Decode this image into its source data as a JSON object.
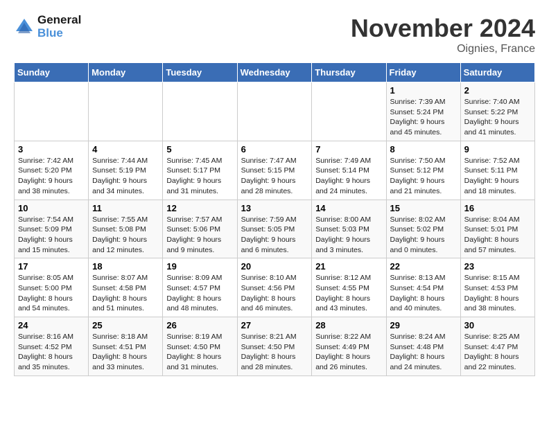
{
  "logo": {
    "line1": "General",
    "line2": "Blue"
  },
  "title": "November 2024",
  "location": "Oignies, France",
  "days_of_week": [
    "Sunday",
    "Monday",
    "Tuesday",
    "Wednesday",
    "Thursday",
    "Friday",
    "Saturday"
  ],
  "weeks": [
    [
      {
        "day": "",
        "info": ""
      },
      {
        "day": "",
        "info": ""
      },
      {
        "day": "",
        "info": ""
      },
      {
        "day": "",
        "info": ""
      },
      {
        "day": "",
        "info": ""
      },
      {
        "day": "1",
        "info": "Sunrise: 7:39 AM\nSunset: 5:24 PM\nDaylight: 9 hours and 45 minutes."
      },
      {
        "day": "2",
        "info": "Sunrise: 7:40 AM\nSunset: 5:22 PM\nDaylight: 9 hours and 41 minutes."
      }
    ],
    [
      {
        "day": "3",
        "info": "Sunrise: 7:42 AM\nSunset: 5:20 PM\nDaylight: 9 hours and 38 minutes."
      },
      {
        "day": "4",
        "info": "Sunrise: 7:44 AM\nSunset: 5:19 PM\nDaylight: 9 hours and 34 minutes."
      },
      {
        "day": "5",
        "info": "Sunrise: 7:45 AM\nSunset: 5:17 PM\nDaylight: 9 hours and 31 minutes."
      },
      {
        "day": "6",
        "info": "Sunrise: 7:47 AM\nSunset: 5:15 PM\nDaylight: 9 hours and 28 minutes."
      },
      {
        "day": "7",
        "info": "Sunrise: 7:49 AM\nSunset: 5:14 PM\nDaylight: 9 hours and 24 minutes."
      },
      {
        "day": "8",
        "info": "Sunrise: 7:50 AM\nSunset: 5:12 PM\nDaylight: 9 hours and 21 minutes."
      },
      {
        "day": "9",
        "info": "Sunrise: 7:52 AM\nSunset: 5:11 PM\nDaylight: 9 hours and 18 minutes."
      }
    ],
    [
      {
        "day": "10",
        "info": "Sunrise: 7:54 AM\nSunset: 5:09 PM\nDaylight: 9 hours and 15 minutes."
      },
      {
        "day": "11",
        "info": "Sunrise: 7:55 AM\nSunset: 5:08 PM\nDaylight: 9 hours and 12 minutes."
      },
      {
        "day": "12",
        "info": "Sunrise: 7:57 AM\nSunset: 5:06 PM\nDaylight: 9 hours and 9 minutes."
      },
      {
        "day": "13",
        "info": "Sunrise: 7:59 AM\nSunset: 5:05 PM\nDaylight: 9 hours and 6 minutes."
      },
      {
        "day": "14",
        "info": "Sunrise: 8:00 AM\nSunset: 5:03 PM\nDaylight: 9 hours and 3 minutes."
      },
      {
        "day": "15",
        "info": "Sunrise: 8:02 AM\nSunset: 5:02 PM\nDaylight: 9 hours and 0 minutes."
      },
      {
        "day": "16",
        "info": "Sunrise: 8:04 AM\nSunset: 5:01 PM\nDaylight: 8 hours and 57 minutes."
      }
    ],
    [
      {
        "day": "17",
        "info": "Sunrise: 8:05 AM\nSunset: 5:00 PM\nDaylight: 8 hours and 54 minutes."
      },
      {
        "day": "18",
        "info": "Sunrise: 8:07 AM\nSunset: 4:58 PM\nDaylight: 8 hours and 51 minutes."
      },
      {
        "day": "19",
        "info": "Sunrise: 8:09 AM\nSunset: 4:57 PM\nDaylight: 8 hours and 48 minutes."
      },
      {
        "day": "20",
        "info": "Sunrise: 8:10 AM\nSunset: 4:56 PM\nDaylight: 8 hours and 46 minutes."
      },
      {
        "day": "21",
        "info": "Sunrise: 8:12 AM\nSunset: 4:55 PM\nDaylight: 8 hours and 43 minutes."
      },
      {
        "day": "22",
        "info": "Sunrise: 8:13 AM\nSunset: 4:54 PM\nDaylight: 8 hours and 40 minutes."
      },
      {
        "day": "23",
        "info": "Sunrise: 8:15 AM\nSunset: 4:53 PM\nDaylight: 8 hours and 38 minutes."
      }
    ],
    [
      {
        "day": "24",
        "info": "Sunrise: 8:16 AM\nSunset: 4:52 PM\nDaylight: 8 hours and 35 minutes."
      },
      {
        "day": "25",
        "info": "Sunrise: 8:18 AM\nSunset: 4:51 PM\nDaylight: 8 hours and 33 minutes."
      },
      {
        "day": "26",
        "info": "Sunrise: 8:19 AM\nSunset: 4:50 PM\nDaylight: 8 hours and 31 minutes."
      },
      {
        "day": "27",
        "info": "Sunrise: 8:21 AM\nSunset: 4:50 PM\nDaylight: 8 hours and 28 minutes."
      },
      {
        "day": "28",
        "info": "Sunrise: 8:22 AM\nSunset: 4:49 PM\nDaylight: 8 hours and 26 minutes."
      },
      {
        "day": "29",
        "info": "Sunrise: 8:24 AM\nSunset: 4:48 PM\nDaylight: 8 hours and 24 minutes."
      },
      {
        "day": "30",
        "info": "Sunrise: 8:25 AM\nSunset: 4:47 PM\nDaylight: 8 hours and 22 minutes."
      }
    ]
  ]
}
